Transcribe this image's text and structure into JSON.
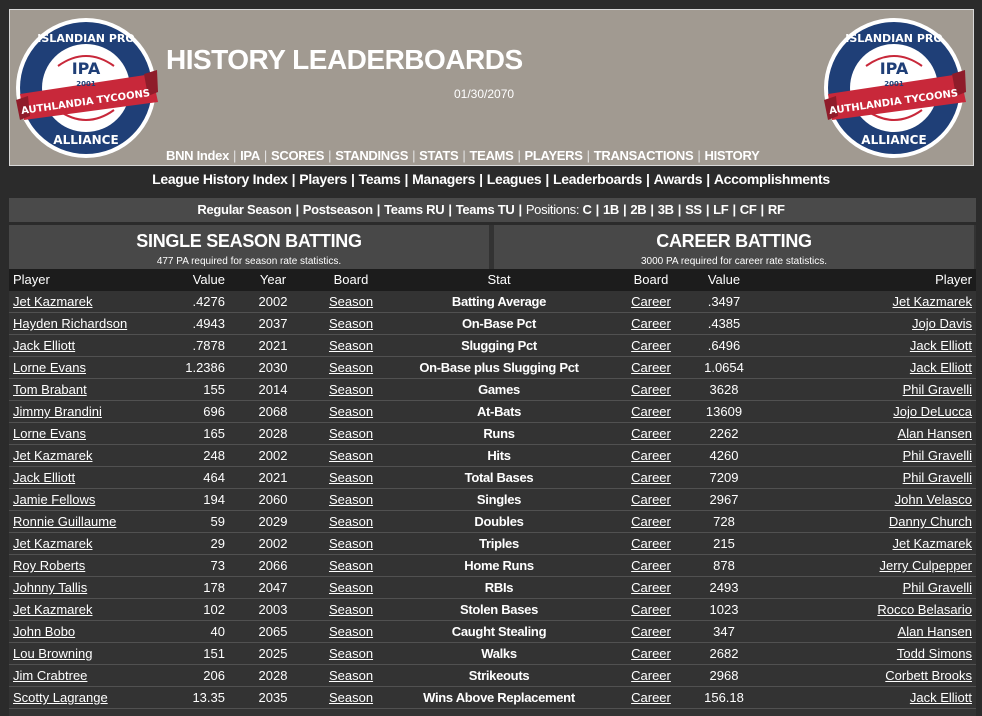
{
  "header": {
    "title": "HISTORY LEADERBOARDS",
    "date": "01/30/2070",
    "logo": {
      "top": "ISLANDIAN PRO",
      "center": "IPA",
      "year": "2001",
      "ribbon": "AUTHLANDIA TYCOONS",
      "bottom": "ALLIANCE"
    }
  },
  "topnav": [
    "BNN Index",
    "IPA",
    "SCORES",
    "STANDINGS",
    "STATS",
    "TEAMS",
    "PLAYERS",
    "TRANSACTIONS",
    "HISTORY"
  ],
  "nav2": [
    "League History Index",
    "Players",
    "Teams",
    "Managers",
    "Leagues",
    "Leaderboards",
    "Awards",
    "Accomplishments"
  ],
  "nav3": {
    "links": [
      "Regular Season",
      "Postseason",
      "Teams RU",
      "Teams TU"
    ],
    "positions_label": "Positions:",
    "positions": [
      "C",
      "1B",
      "2B",
      "3B",
      "SS",
      "LF",
      "CF",
      "RF"
    ]
  },
  "single_season": {
    "title": "SINGLE SEASON BATTING",
    "note": "477 PA required for season rate statistics."
  },
  "career": {
    "title": "CAREER BATTING",
    "note": "3000 PA required for career rate statistics."
  },
  "columns": {
    "player": "Player",
    "value": "Value",
    "year": "Year",
    "board": "Board",
    "stat": "Stat",
    "cboard": "Board",
    "cvalue": "Value",
    "cplayer": "Player"
  },
  "rows": [
    {
      "player": "Jet Kazmarek",
      "value": ".4276",
      "year": "2002",
      "board": "Season",
      "stat": "Batting Average",
      "cboard": "Career",
      "cvalue": ".3497",
      "cplayer": "Jet Kazmarek"
    },
    {
      "player": "Hayden Richardson",
      "value": ".4943",
      "year": "2037",
      "board": "Season",
      "stat": "On-Base Pct",
      "cboard": "Career",
      "cvalue": ".4385",
      "cplayer": "Jojo Davis"
    },
    {
      "player": "Jack Elliott",
      "value": ".7878",
      "year": "2021",
      "board": "Season",
      "stat": "Slugging Pct",
      "cboard": "Career",
      "cvalue": ".6496",
      "cplayer": "Jack Elliott"
    },
    {
      "player": "Lorne Evans",
      "value": "1.2386",
      "year": "2030",
      "board": "Season",
      "stat": "On-Base plus Slugging Pct",
      "cboard": "Career",
      "cvalue": "1.0654",
      "cplayer": "Jack Elliott"
    },
    {
      "player": "Tom Brabant",
      "value": "155",
      "year": "2014",
      "board": "Season",
      "stat": "Games",
      "cboard": "Career",
      "cvalue": "3628",
      "cplayer": "Phil Gravelli"
    },
    {
      "player": "Jimmy Brandini",
      "value": "696",
      "year": "2068",
      "board": "Season",
      "stat": "At-Bats",
      "cboard": "Career",
      "cvalue": "13609",
      "cplayer": "Jojo DeLucca"
    },
    {
      "player": "Lorne Evans",
      "value": "165",
      "year": "2028",
      "board": "Season",
      "stat": "Runs",
      "cboard": "Career",
      "cvalue": "2262",
      "cplayer": "Alan Hansen"
    },
    {
      "player": "Jet Kazmarek",
      "value": "248",
      "year": "2002",
      "board": "Season",
      "stat": "Hits",
      "cboard": "Career",
      "cvalue": "4260",
      "cplayer": "Phil Gravelli"
    },
    {
      "player": "Jack Elliott",
      "value": "464",
      "year": "2021",
      "board": "Season",
      "stat": "Total Bases",
      "cboard": "Career",
      "cvalue": "7209",
      "cplayer": "Phil Gravelli"
    },
    {
      "player": "Jamie Fellows",
      "value": "194",
      "year": "2060",
      "board": "Season",
      "stat": "Singles",
      "cboard": "Career",
      "cvalue": "2967",
      "cplayer": "John Velasco"
    },
    {
      "player": "Ronnie Guillaume",
      "value": "59",
      "year": "2029",
      "board": "Season",
      "stat": "Doubles",
      "cboard": "Career",
      "cvalue": "728",
      "cplayer": "Danny Church"
    },
    {
      "player": "Jet Kazmarek",
      "value": "29",
      "year": "2002",
      "board": "Season",
      "stat": "Triples",
      "cboard": "Career",
      "cvalue": "215",
      "cplayer": "Jet Kazmarek"
    },
    {
      "player": "Roy Roberts",
      "value": "73",
      "year": "2066",
      "board": "Season",
      "stat": "Home Runs",
      "cboard": "Career",
      "cvalue": "878",
      "cplayer": "Jerry Culpepper"
    },
    {
      "player": "Johnny Tallis",
      "value": "178",
      "year": "2047",
      "board": "Season",
      "stat": "RBIs",
      "cboard": "Career",
      "cvalue": "2493",
      "cplayer": "Phil Gravelli"
    },
    {
      "player": "Jet Kazmarek",
      "value": "102",
      "year": "2003",
      "board": "Season",
      "stat": "Stolen Bases",
      "cboard": "Career",
      "cvalue": "1023",
      "cplayer": "Rocco Belasario"
    },
    {
      "player": "John Bobo",
      "value": "40",
      "year": "2065",
      "board": "Season",
      "stat": "Caught Stealing",
      "cboard": "Career",
      "cvalue": "347",
      "cplayer": "Alan Hansen"
    },
    {
      "player": "Lou Browning",
      "value": "151",
      "year": "2025",
      "board": "Season",
      "stat": "Walks",
      "cboard": "Career",
      "cvalue": "2682",
      "cplayer": "Todd Simons"
    },
    {
      "player": "Jim Crabtree",
      "value": "206",
      "year": "2028",
      "board": "Season",
      "stat": "Strikeouts",
      "cboard": "Career",
      "cvalue": "2968",
      "cplayer": "Corbett Brooks"
    },
    {
      "player": "Scotty Lagrange",
      "value": "13.35",
      "year": "2035",
      "board": "Season",
      "stat": "Wins Above Replacement",
      "cboard": "Career",
      "cvalue": "156.18",
      "cplayer": "Jack Elliott"
    }
  ],
  "colors": {
    "header_bg": "#a19a91",
    "page_bg": "#2b2b2b",
    "logo_navy": "#1f3f77",
    "logo_red": "#c8283a"
  }
}
